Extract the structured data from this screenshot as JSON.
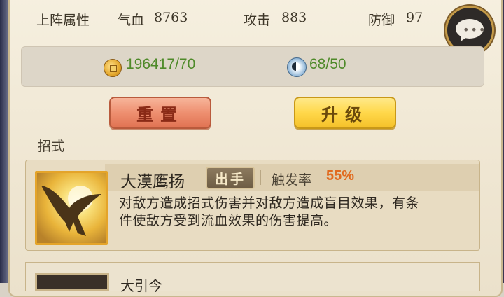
{
  "stats": {
    "label": "上阵属性",
    "hp_label": "气血",
    "hp_value": "8763",
    "attack_label": "攻击",
    "attack_value": "883",
    "defense_label": "防御",
    "defense_value": "97"
  },
  "resources": {
    "coins": "196417/70",
    "spirit": "68/50",
    "coin_icon": "coin-icon",
    "spirit_icon": "yin-yang-icon"
  },
  "buttons": {
    "reset": "重置",
    "upgrade": "升级"
  },
  "section": {
    "moves_label": "招式"
  },
  "skill": {
    "name": "大漠鹰扬",
    "tag": "出手",
    "trigger_label": "触发率",
    "trigger_value": "55%",
    "description": "对敌方造成招式伤害并对敌方造成盲目效果，有条件使敌方受到流血效果的伤害提高。"
  },
  "next_skill": {
    "name": "大引今"
  },
  "colors": {
    "accent_green": "#4f8a2a",
    "trigger_orange": "#e16a1e",
    "button_red": "#ee8f70",
    "button_yellow": "#ffd84a"
  }
}
